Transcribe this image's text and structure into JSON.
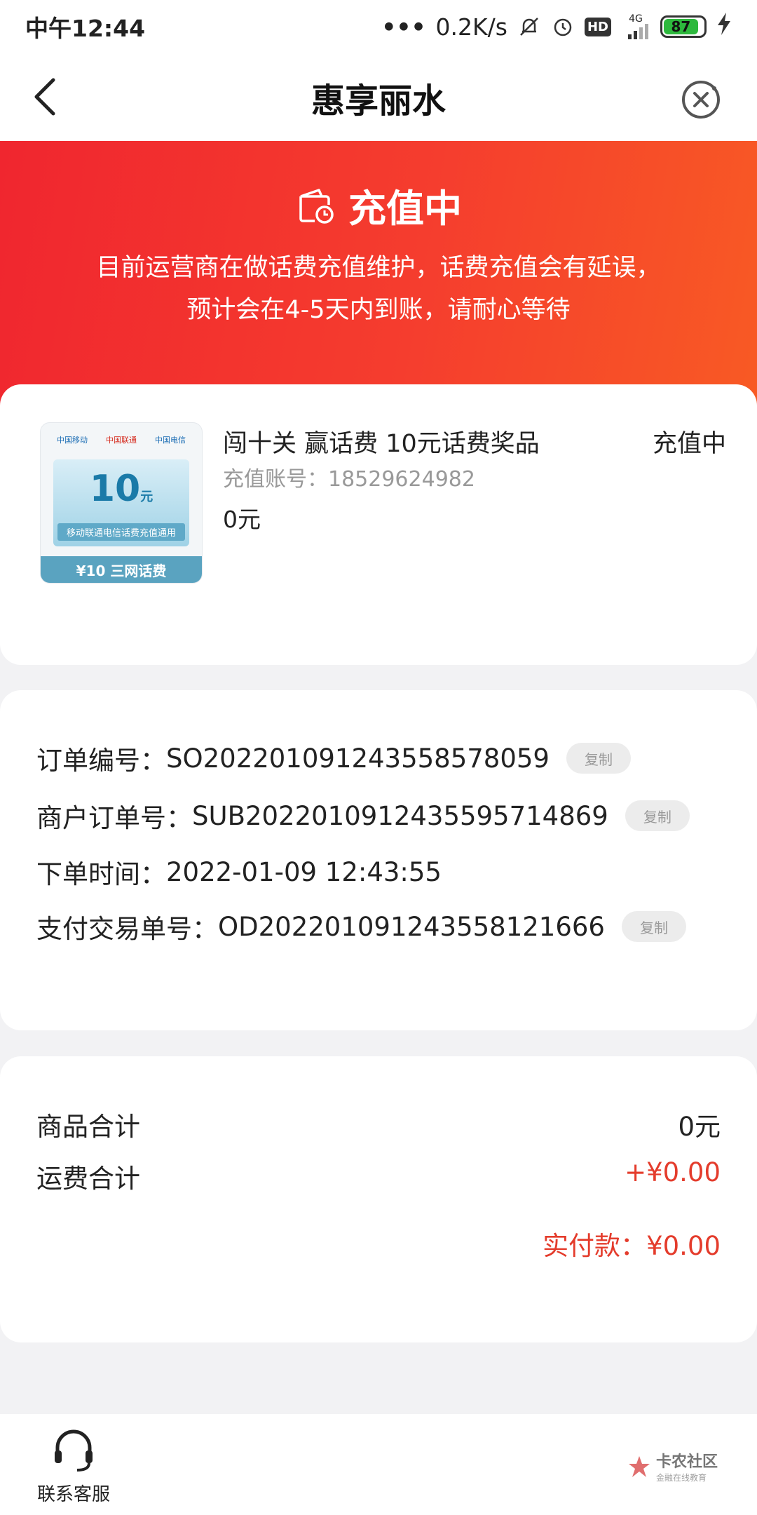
{
  "status_bar": {
    "time": "中午12:44",
    "network_speed": "0.2K/s",
    "network_type": "4G",
    "hd_label": "HD",
    "battery_level": "87"
  },
  "nav": {
    "title": "惠享丽水",
    "back_icon": "chevron-left-icon",
    "close_icon": "close-circle-icon"
  },
  "hero": {
    "status": "充值中",
    "message_line1": "目前运营商在做话费充值维护，话费充值会有延误，",
    "message_line2": "预计会在4-5天内到账，请耐心等待"
  },
  "product": {
    "title": "闯十关 赢话费 10元话费奖品",
    "status": "充值中",
    "account_label": "充值账号：",
    "account_value": "18529624982",
    "price": "0元",
    "thumbnail": {
      "logo1": "中国移动",
      "logo2": "中国联通",
      "logo3": "中国电信",
      "amount": "10",
      "amount_unit": "元",
      "subtitle": "移动联通电信话费充值通用",
      "footer": "¥10 三网话费"
    }
  },
  "order": {
    "order_no_label": "订单编号：",
    "order_no": "SO2022010912435585780​59",
    "merchant_no_label": "商户订单号：",
    "merchant_no": "SUB2022010912435595714869",
    "time_label": "下单时间：",
    "time": "2022-01-09 12:43:55",
    "pay_no_label": "支付交易单号：",
    "pay_no": "OD2022010912435581216​66",
    "copy_label": "复制"
  },
  "summary": {
    "goods_label": "商品合计",
    "goods_value": "0元",
    "shipping_label": "运费合计",
    "shipping_value": "+¥0.00",
    "paid_label": "实付款：",
    "paid_value": "¥0.00"
  },
  "bottom": {
    "support_label": "联系客服",
    "watermark_title": "卡农社区",
    "watermark_sub": "金融在线教育"
  },
  "colors": {
    "accent_red": "#e43c2c",
    "hero_gradient_start": "#f0262f",
    "hero_gradient_end": "#f85a24"
  }
}
